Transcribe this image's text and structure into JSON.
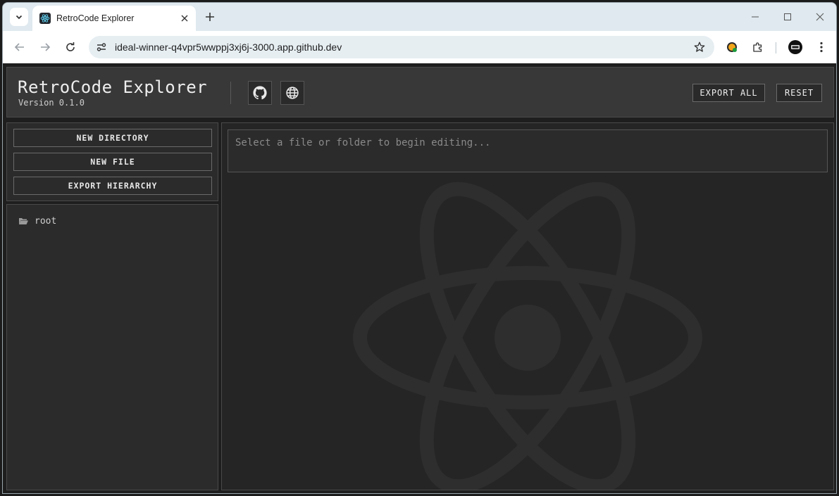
{
  "browser": {
    "tab_title": "RetroCode Explorer",
    "url": "ideal-winner-q4vpr5wwppj3xj6j-3000.app.github.dev"
  },
  "app": {
    "title": "RetroCode Explorer",
    "version": "Version 0.1.0",
    "export_all_label": "EXPORT ALL",
    "reset_label": "RESET",
    "icons": [
      "github-icon",
      "globe-icon"
    ]
  },
  "sidebar": {
    "new_directory_label": "NEW DIRECTORY",
    "new_file_label": "NEW FILE",
    "export_hierarchy_label": "EXPORT HIERARCHY",
    "tree": [
      {
        "label": "root",
        "icon": "folder-open-icon"
      }
    ]
  },
  "editor": {
    "placeholder": "Select a file or folder to begin editing...",
    "background_icon": "react-logo-icon"
  },
  "colors": {
    "app_background": "#1e1e1e",
    "header_background": "#383838",
    "panel_background": "#2b2b2b",
    "text": "#eeeeee"
  }
}
